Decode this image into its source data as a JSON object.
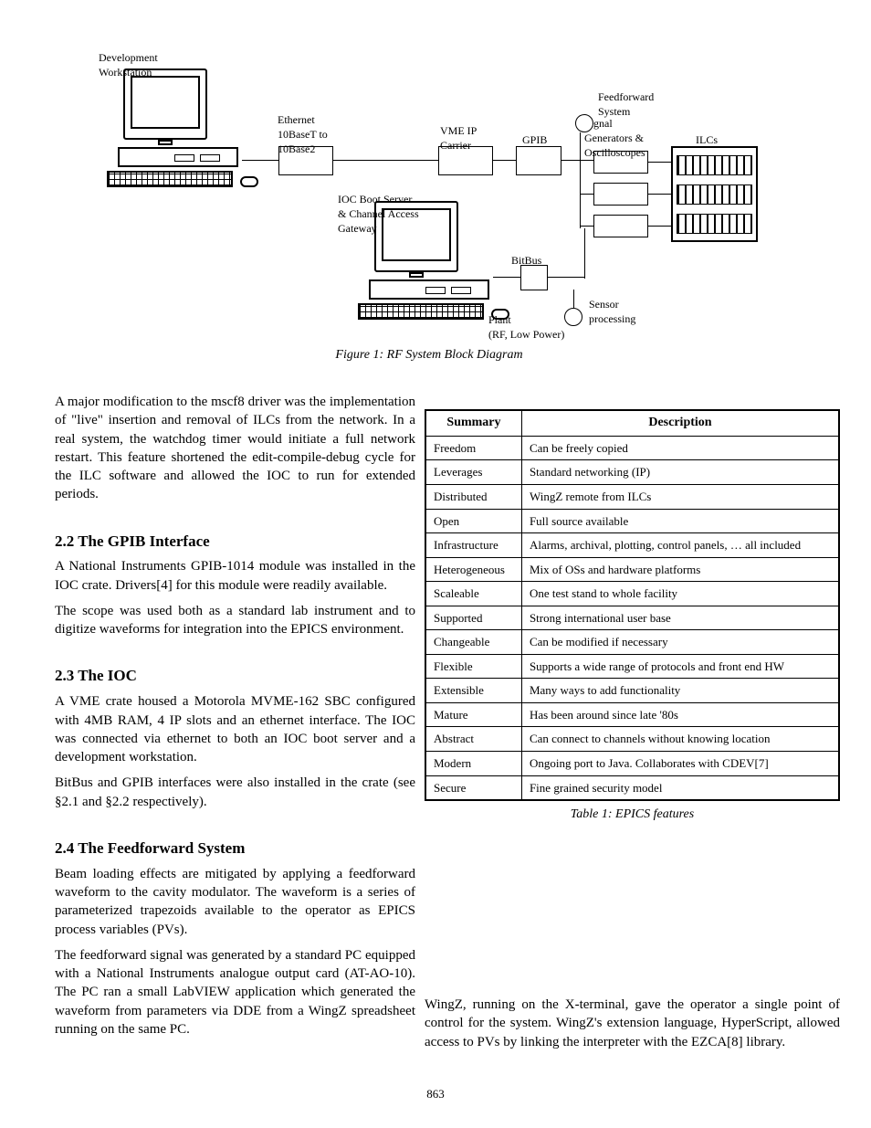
{
  "diagram": {
    "labels": {
      "dev_ws": "Development\nWorkstation",
      "ethernet": "Ethernet\n10BaseT to\n10Base2",
      "vme": "VME IP\nCarrier",
      "gpib": "GPIB",
      "bitbus": "BitBus",
      "sig_gen": "Signal\nGenerators &\nOscilloscopes",
      "ilcs": "ILCs",
      "ioc_boot": "IOC Boot Server\n& Channel Access\nGateway",
      "feedfwd": "Feedforward\nSystem",
      "plant": "Plant\n(RF, Low Power)",
      "sensor": "Sensor\nprocessing"
    },
    "figcap": "Figure 1: RF System Block Diagram"
  },
  "left": {
    "p1": "A major modification to the mscf8 driver was the implementation of \"live\" insertion and removal of ILCs from the network. In a real system, the watchdog timer would initiate a full network restart. This feature shortened the edit-compile-debug cycle for the ILC software and allowed the IOC to run for extended periods.",
    "s1": "2.2 The GPIB Interface",
    "p2": "A National Instruments GPIB-1014 module was installed in the IOC crate. Drivers[4] for this module were readily available.",
    "p3": "The scope was used both as a standard lab instrument and to digitize waveforms for integration into the EPICS environment.",
    "s2": "2.3 The IOC",
    "p4": "A VME crate housed a Motorola MVME-162 SBC configured with 4MB RAM, 4 IP slots and an ethernet interface. The IOC was connected via ethernet to both an IOC boot server and a development workstation.",
    "p5": "BitBus and GPIB interfaces were also installed in the crate (see §2.1 and §2.2 respectively).",
    "s3": "2.4 The Feedforward System",
    "p6": "Beam loading effects are mitigated by applying a feedforward waveform to the cavity modulator. The waveform is a series of parameterized trapezoids available to the operator as EPICS process variables (PVs).",
    "p7": "The feedforward signal was generated by a standard PC equipped with a National Instruments analogue output card (AT-AO-10). The PC ran a small LabVIEW application which generated the waveform from parameters via DDE from a WingZ spreadsheet running on the same PC."
  },
  "table": {
    "head": [
      "Summary",
      "Description"
    ],
    "rows": [
      [
        "Freedom",
        "Can be freely copied"
      ],
      [
        "Leverages",
        "Standard networking (IP)"
      ],
      [
        "Distributed",
        "WingZ remote from ILCs"
      ],
      [
        "Open",
        "Full source available"
      ],
      [
        "Infrastructure",
        "Alarms, archival, plotting, control panels, … all included"
      ],
      [
        "Heterogeneous",
        "Mix of OSs and hardware platforms"
      ],
      [
        "Scaleable",
        "One test stand to whole facility"
      ],
      [
        "Supported",
        "Strong international user base"
      ],
      [
        "Changeable",
        "Can be modified if necessary"
      ],
      [
        "Flexible",
        "Supports a wide range of protocols and front end HW"
      ],
      [
        "Extensible",
        "Many ways to add functionality"
      ],
      [
        "Mature",
        "Has been around since late '80s"
      ],
      [
        "Abstract",
        "Can connect to channels without knowing location"
      ],
      [
        "Modern",
        "Ongoing port to Java. Collaborates with CDEV[7]"
      ],
      [
        "Secure",
        "Fine grained security model"
      ]
    ],
    "caption": "Table 1: EPICS features"
  },
  "tail": "WingZ, running on the X-terminal, gave the operator a single point of control for the system. WingZ's extension language, HyperScript, allowed access to PVs by linking the interpreter with the EZCA[8] library.",
  "page": "863"
}
